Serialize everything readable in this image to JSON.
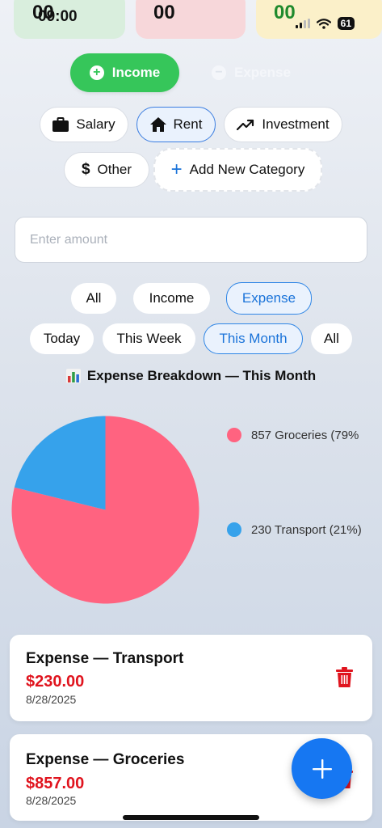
{
  "summary": {
    "income_value": "00",
    "expense_value": "00",
    "balance_value": "00",
    "colors": {
      "income": "#d9eedd",
      "expense": "#f7d7da",
      "balance": "#fbf0c9",
      "balance_text": "#1f8a2d"
    }
  },
  "status_bar": {
    "time": "09:00",
    "battery": "61",
    "icons": [
      "signal-icon",
      "wifi-icon",
      "battery-icon"
    ]
  },
  "type_toggle": {
    "income_label": "Income",
    "expense_label": "Expense",
    "active": "Income"
  },
  "categories": {
    "items": [
      {
        "label": "Salary",
        "icon": "briefcase-icon"
      },
      {
        "label": "Rent",
        "icon": "home-icon",
        "selected": true
      },
      {
        "label": "Investment",
        "icon": "trending-up-icon"
      },
      {
        "label": "Other",
        "icon": "dollar-icon"
      }
    ],
    "add_label": "Add New Category"
  },
  "amount_input": {
    "placeholder": "Enter amount",
    "value": ""
  },
  "type_filters": {
    "items": [
      "All",
      "Income",
      "Expense"
    ],
    "selected": "Expense"
  },
  "period_filters": {
    "items": [
      "Today",
      "This Week",
      "This Month",
      "All"
    ],
    "selected": "This Month"
  },
  "breakdown": {
    "title": "Expense Breakdown — This Month",
    "icon": "bar-chart-icon",
    "legend": [
      {
        "label": "857 Groceries (79%",
        "color": "#ff6380"
      },
      {
        "label": "230 Transport (21%)",
        "color": "#36a2eb"
      }
    ]
  },
  "chart_data": {
    "type": "pie",
    "slices": [
      {
        "name": "Groceries",
        "value": 857,
        "color": "#ff6380"
      },
      {
        "name": "Transport",
        "value": 230,
        "color": "#36a2eb"
      }
    ]
  },
  "transactions": [
    {
      "title": "Expense — Transport",
      "amount": "$230.00",
      "date": "8/28/2025"
    },
    {
      "title": "Expense — Groceries",
      "amount": "$857.00",
      "date": "8/28/2025"
    }
  ],
  "fab": {
    "icon": "plus-icon"
  }
}
